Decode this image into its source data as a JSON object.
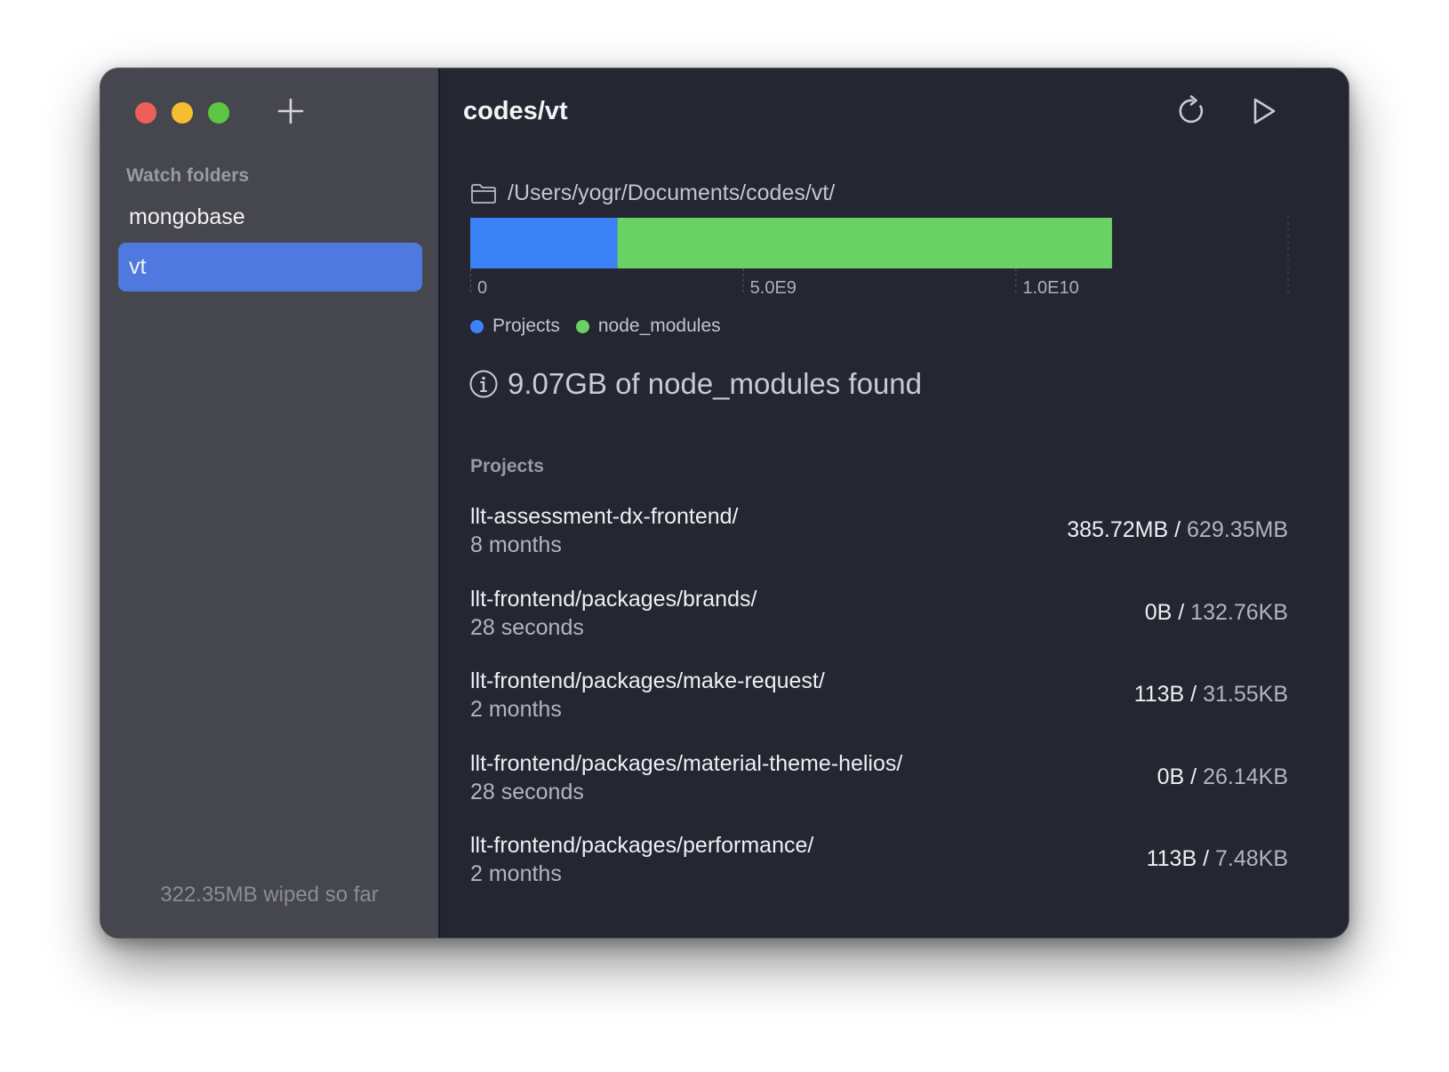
{
  "sidebar": {
    "section_label": "Watch folders",
    "folders": [
      {
        "label": "mongobase",
        "selected": false
      },
      {
        "label": "vt",
        "selected": true
      }
    ],
    "wiped_text": "322.35MB wiped so far"
  },
  "main": {
    "title": "codes/vt",
    "path": "/Users/yogr/Documents/codes/vt/",
    "info_text": "9.07GB of node_modules found",
    "projects_label": "Projects",
    "projects": [
      {
        "name": "llt-assessment-dx-frontend/",
        "age": "8 months",
        "size": "385.72MB",
        "total": "629.35MB"
      },
      {
        "name": "llt-frontend/packages/brands/",
        "age": "28 seconds",
        "size": "0B",
        "total": "132.76KB"
      },
      {
        "name": "llt-frontend/packages/make-request/",
        "age": "2 months",
        "size": "113B",
        "total": "31.55KB"
      },
      {
        "name": "llt-frontend/packages/material-theme-helios/",
        "age": "28 seconds",
        "size": "0B",
        "total": "26.14KB"
      },
      {
        "name": "llt-frontend/packages/performance/",
        "age": "2 months",
        "size": "113B",
        "total": "7.48KB"
      }
    ]
  },
  "icons": {
    "add": "plus-icon",
    "refresh": "refresh-icon",
    "run": "play-icon",
    "folder": "folder-icon",
    "info": "info-icon"
  },
  "colors": {
    "projects": "#3b82f6",
    "node_modules": "#6ad164",
    "selected": "#4f79de"
  },
  "chart_data": {
    "type": "bar",
    "orientation": "horizontal",
    "stacked": true,
    "series": [
      {
        "name": "Projects",
        "value": 2700000000,
        "color": "#3b82f6"
      },
      {
        "name": "node_modules",
        "value": 9070000000,
        "color": "#6ad164"
      }
    ],
    "xlim": [
      0,
      15000000000
    ],
    "ticks": [
      0,
      5000000000,
      10000000000
    ],
    "tick_labels": [
      "0",
      "5.0E9",
      "1.0E10"
    ],
    "legend_position": "bottom-left"
  }
}
